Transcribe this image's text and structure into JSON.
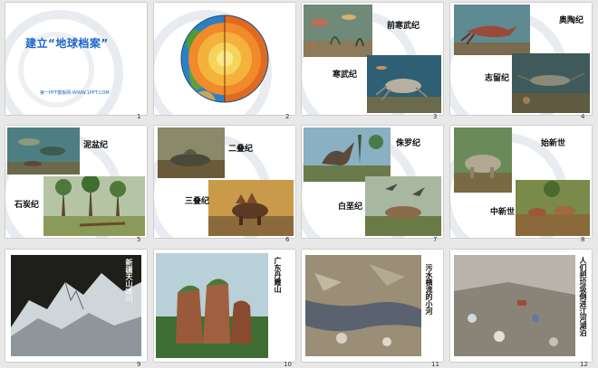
{
  "slides": [
    {
      "number": "1",
      "title_left": "建立",
      "title_quote": "“地球档案”",
      "subtitle": "第一PPT模板网-WWW.1PPT.COM"
    },
    {
      "number": "2"
    },
    {
      "number": "3",
      "labels": [
        "前寒武纪",
        "寒武纪"
      ]
    },
    {
      "number": "4",
      "labels": [
        "奥陶纪",
        "志留纪"
      ]
    },
    {
      "number": "5",
      "labels": [
        "泥盆纪",
        "石炭纪"
      ]
    },
    {
      "number": "6",
      "labels": [
        "二叠纪",
        "三叠纪"
      ]
    },
    {
      "number": "7",
      "labels": [
        "侏罗纪",
        "白垩纪"
      ]
    },
    {
      "number": "8",
      "labels": [
        "始新世",
        "中新世"
      ]
    },
    {
      "number": "9",
      "caption": "新疆天山冰川"
    },
    {
      "number": "10",
      "caption": "广东丹霞山"
    },
    {
      "number": "11",
      "caption": "污水横流的小河"
    },
    {
      "number": "12",
      "caption": "人们把垃圾倒进江河湖泊"
    }
  ],
  "colors": {
    "title_blue": "#1b66c9",
    "background": "#e8e8e8"
  }
}
